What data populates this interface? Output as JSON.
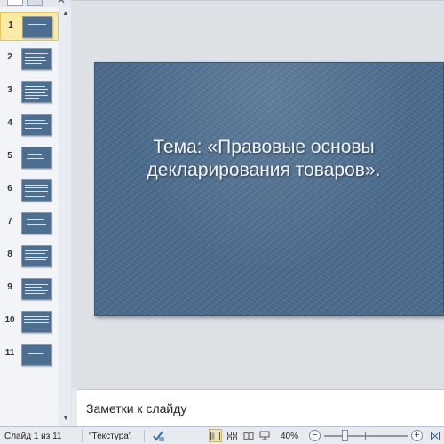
{
  "slide_panel": {
    "close_glyph": "✕",
    "thumbnails": [
      {
        "number": "1",
        "selected": true
      },
      {
        "number": "2",
        "selected": false
      },
      {
        "number": "3",
        "selected": false
      },
      {
        "number": "4",
        "selected": false
      },
      {
        "number": "5",
        "selected": false
      },
      {
        "number": "6",
        "selected": false
      },
      {
        "number": "7",
        "selected": false
      },
      {
        "number": "8",
        "selected": false
      },
      {
        "number": "9",
        "selected": false
      },
      {
        "number": "10",
        "selected": false
      },
      {
        "number": "11",
        "selected": false
      }
    ]
  },
  "slide": {
    "title": "Тема: «Правовые основы декларирования товаров».",
    "background_color": "#4a6b8e"
  },
  "notes": {
    "placeholder": "Заметки к слайду"
  },
  "status_bar": {
    "slide_counter": "Слайд 1 из 11",
    "theme_name": "\"Текстура\"",
    "zoom_level": "40%",
    "zoom_minus": "−",
    "zoom_plus": "+",
    "zoom_fraction": 0.4
  },
  "colors": {
    "accent_selection": "#fbe6a0",
    "slide_blue": "#4a6b8e"
  }
}
